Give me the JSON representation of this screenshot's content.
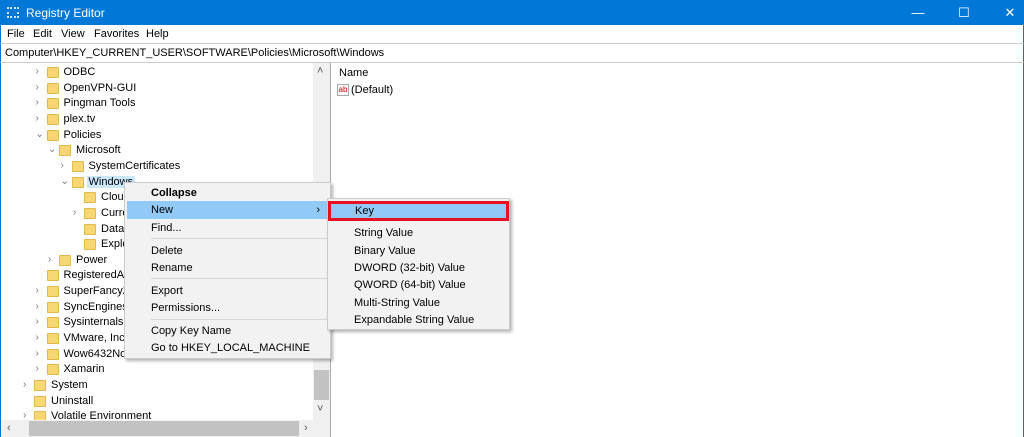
{
  "window": {
    "title": "Registry Editor",
    "minimize": "—",
    "maximize": "☐",
    "close": "✕"
  },
  "menubar": [
    "File",
    "Edit",
    "View",
    "Favorites",
    "Help"
  ],
  "address": "Computer\\HKEY_CURRENT_USER\\SOFTWARE\\Policies\\Microsoft\\Windows",
  "tree": [
    {
      "label": "ODBC",
      "level": 1,
      "chev": ">"
    },
    {
      "label": "OpenVPN-GUI",
      "level": 1,
      "chev": ">"
    },
    {
      "label": "Pingman Tools",
      "level": 1,
      "chev": ">"
    },
    {
      "label": "plex.tv",
      "level": 1,
      "chev": ">"
    },
    {
      "label": "Policies",
      "level": 1,
      "chev": "v"
    },
    {
      "label": "Microsoft",
      "level": 2,
      "chev": "v"
    },
    {
      "label": "SystemCertificates",
      "level": 3,
      "chev": ">"
    },
    {
      "label": "Windows",
      "level": 3,
      "chev": "v",
      "selected": true
    },
    {
      "label": "CloudContent",
      "level": 4,
      "chev": ""
    },
    {
      "label": "CurrentVersion",
      "level": 4,
      "chev": ">"
    },
    {
      "label": "DataCollection",
      "level": 4,
      "chev": ""
    },
    {
      "label": "Explorer",
      "level": 4,
      "chev": ""
    },
    {
      "label": "Power",
      "level": 2,
      "chev": ">"
    },
    {
      "label": "RegisteredApplications",
      "level": 1,
      "chev": ""
    },
    {
      "label": "SuperFancyZones",
      "level": 1,
      "chev": ">"
    },
    {
      "label": "SyncEngines",
      "level": 1,
      "chev": ">"
    },
    {
      "label": "Sysinternals",
      "level": 1,
      "chev": ">"
    },
    {
      "label": "VMware, Inc.",
      "level": 1,
      "chev": ">"
    },
    {
      "label": "Wow6432Node",
      "level": 1,
      "chev": ">"
    },
    {
      "label": "Xamarin",
      "level": 1,
      "chev": ">"
    },
    {
      "label": "System",
      "level": 0,
      "chev": ">"
    },
    {
      "label": "Uninstall",
      "level": 0,
      "chev": ""
    },
    {
      "label": "Volatile Environment",
      "level": 0,
      "chev": ">"
    }
  ],
  "values": {
    "column_name": "Name",
    "items": [
      {
        "name": "(Default)",
        "icon": "ab"
      }
    ]
  },
  "context_menu": {
    "collapse": "Collapse",
    "new": "New",
    "find": "Find...",
    "delete": "Delete",
    "rename": "Rename",
    "export": "Export",
    "permissions": "Permissions...",
    "copy_key_name": "Copy Key Name",
    "goto": "Go to HKEY_LOCAL_MACHINE"
  },
  "submenu": [
    "Key",
    "String Value",
    "Binary Value",
    "DWORD (32-bit) Value",
    "QWORD (64-bit) Value",
    "Multi-String Value",
    "Expandable String Value"
  ],
  "colors": {
    "accent": "#0078d7",
    "highlight": "#91c9f7",
    "annotation": "#e81123"
  }
}
